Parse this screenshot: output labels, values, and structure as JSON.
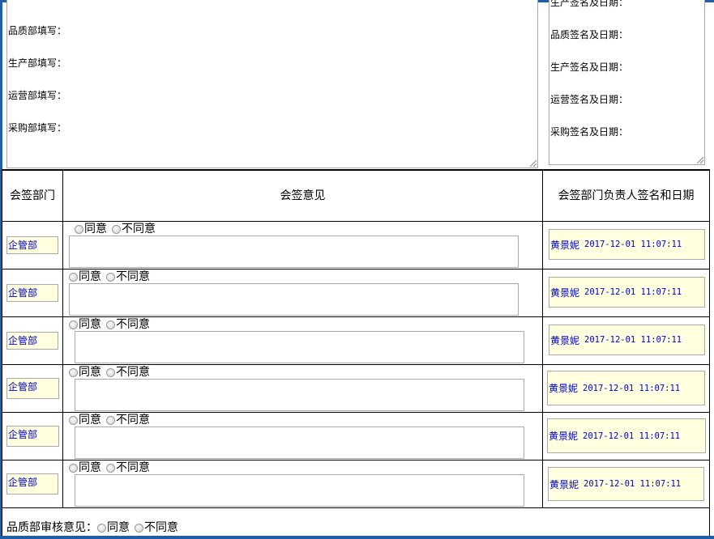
{
  "fill_box": {
    "lines": [
      "品质部填写：",
      "生产部填写：",
      "运营部填写：",
      "采购部填写："
    ]
  },
  "sign_box": {
    "lines": [
      "生产签名及日期：",
      "品质签名及日期：",
      "生产签名及日期：",
      "运营签名及日期：",
      "采购签名及日期："
    ]
  },
  "headers": {
    "dept": "会签部门",
    "opinion": "会签意见",
    "signer": "会签部门负责人签名和日期"
  },
  "radio": {
    "agree": "同意",
    "disagree": "不同意"
  },
  "rows": [
    {
      "dept": "企管部",
      "name": "黄景妮",
      "time": "2017-12-01 11:07:11"
    },
    {
      "dept": "企管部",
      "name": "黄景妮",
      "time": "2017-12-01 11:07:11"
    },
    {
      "dept": "企管部",
      "name": "黄景妮",
      "time": "2017-12-01 11:07:11"
    },
    {
      "dept": "企管部",
      "name": "黄景妮",
      "time": "2017-12-01 11:07:11"
    },
    {
      "dept": "企管部",
      "name": "黄景妮",
      "time": "2017-12-01 11:07:11"
    },
    {
      "dept": "企管部",
      "name": "黄景妮",
      "time": "2017-12-01 11:07:11"
    }
  ],
  "footer": {
    "label": "品质部审核意见：",
    "agree": "同意",
    "disagree": "不同意"
  },
  "colors": {
    "accent": "#1f5fa8",
    "field_bg": "#ffffe0",
    "link_text": "#0000cc"
  }
}
